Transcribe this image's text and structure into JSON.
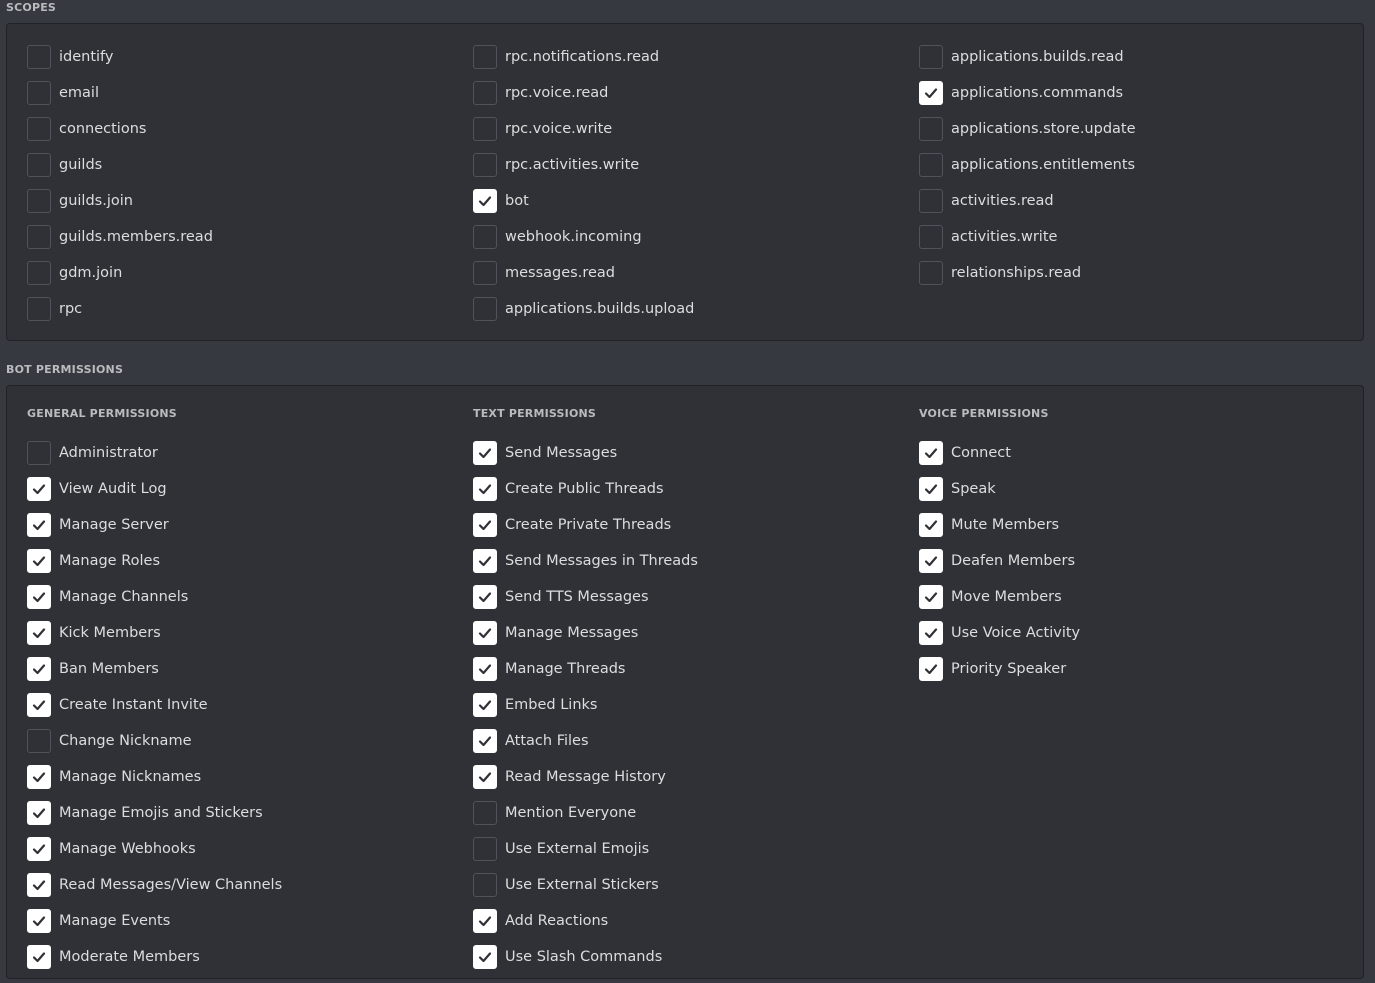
{
  "scopes": {
    "title": "SCOPES",
    "columns": [
      {
        "items": [
          {
            "label": "identify",
            "checked": false
          },
          {
            "label": "email",
            "checked": false
          },
          {
            "label": "connections",
            "checked": false
          },
          {
            "label": "guilds",
            "checked": false
          },
          {
            "label": "guilds.join",
            "checked": false
          },
          {
            "label": "guilds.members.read",
            "checked": false
          },
          {
            "label": "gdm.join",
            "checked": false
          },
          {
            "label": "rpc",
            "checked": false
          }
        ]
      },
      {
        "items": [
          {
            "label": "rpc.notifications.read",
            "checked": false
          },
          {
            "label": "rpc.voice.read",
            "checked": false
          },
          {
            "label": "rpc.voice.write",
            "checked": false
          },
          {
            "label": "rpc.activities.write",
            "checked": false
          },
          {
            "label": "bot",
            "checked": true
          },
          {
            "label": "webhook.incoming",
            "checked": false
          },
          {
            "label": "messages.read",
            "checked": false
          },
          {
            "label": "applications.builds.upload",
            "checked": false
          }
        ]
      },
      {
        "items": [
          {
            "label": "applications.builds.read",
            "checked": false
          },
          {
            "label": "applications.commands",
            "checked": true
          },
          {
            "label": "applications.store.update",
            "checked": false
          },
          {
            "label": "applications.entitlements",
            "checked": false
          },
          {
            "label": "activities.read",
            "checked": false
          },
          {
            "label": "activities.write",
            "checked": false
          },
          {
            "label": "relationships.read",
            "checked": false
          }
        ]
      }
    ]
  },
  "bot_permissions": {
    "title": "BOT PERMISSIONS",
    "columns": [
      {
        "title": "GENERAL PERMISSIONS",
        "items": [
          {
            "label": "Administrator",
            "checked": false
          },
          {
            "label": "View Audit Log",
            "checked": true
          },
          {
            "label": "Manage Server",
            "checked": true
          },
          {
            "label": "Manage Roles",
            "checked": true
          },
          {
            "label": "Manage Channels",
            "checked": true
          },
          {
            "label": "Kick Members",
            "checked": true
          },
          {
            "label": "Ban Members",
            "checked": true
          },
          {
            "label": "Create Instant Invite",
            "checked": true
          },
          {
            "label": "Change Nickname",
            "checked": false
          },
          {
            "label": "Manage Nicknames",
            "checked": true
          },
          {
            "label": "Manage Emojis and Stickers",
            "checked": true
          },
          {
            "label": "Manage Webhooks",
            "checked": true
          },
          {
            "label": "Read Messages/View Channels",
            "checked": true
          },
          {
            "label": "Manage Events",
            "checked": true
          },
          {
            "label": "Moderate Members",
            "checked": true
          }
        ]
      },
      {
        "title": "TEXT PERMISSIONS",
        "items": [
          {
            "label": "Send Messages",
            "checked": true
          },
          {
            "label": "Create Public Threads",
            "checked": true
          },
          {
            "label": "Create Private Threads",
            "checked": true
          },
          {
            "label": "Send Messages in Threads",
            "checked": true
          },
          {
            "label": "Send TTS Messages",
            "checked": true
          },
          {
            "label": "Manage Messages",
            "checked": true
          },
          {
            "label": "Manage Threads",
            "checked": true
          },
          {
            "label": "Embed Links",
            "checked": true
          },
          {
            "label": "Attach Files",
            "checked": true
          },
          {
            "label": "Read Message History",
            "checked": true
          },
          {
            "label": "Mention Everyone",
            "checked": false
          },
          {
            "label": "Use External Emojis",
            "checked": false
          },
          {
            "label": "Use External Stickers",
            "checked": false
          },
          {
            "label": "Add Reactions",
            "checked": true
          },
          {
            "label": "Use Slash Commands",
            "checked": true
          }
        ]
      },
      {
        "title": "VOICE PERMISSIONS",
        "items": [
          {
            "label": "Connect",
            "checked": true
          },
          {
            "label": "Speak",
            "checked": true
          },
          {
            "label": "Mute Members",
            "checked": true
          },
          {
            "label": "Deafen Members",
            "checked": true
          },
          {
            "label": "Move Members",
            "checked": true
          },
          {
            "label": "Use Voice Activity",
            "checked": true
          },
          {
            "label": "Priority Speaker",
            "checked": true
          }
        ]
      }
    ]
  },
  "colors": {
    "background": "#36393f",
    "panel": "#2f3136",
    "checkbox_checked": "#ffffff",
    "checkmark": "#2f3136"
  },
  "icons": {
    "check": "checkmark-icon"
  }
}
